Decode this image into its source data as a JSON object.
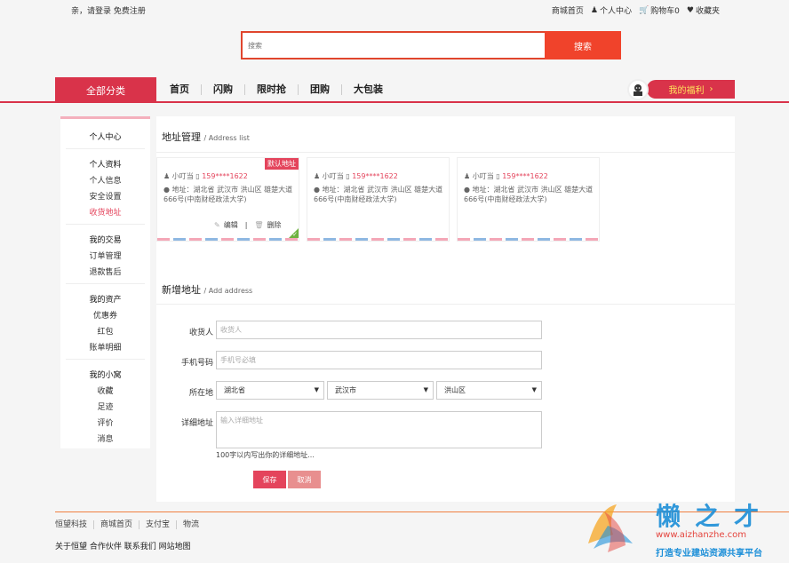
{
  "topbar": {
    "greeting": "亲，请登录 免费注册",
    "links": [
      "商城首页",
      "个人中心",
      "购物车0",
      "收藏夹"
    ]
  },
  "search": {
    "placeholder": "搜索",
    "button": "搜索"
  },
  "nav": {
    "all_categories": "全部分类",
    "links": [
      "首页",
      "闪购",
      "限时抢",
      "团购",
      "大包装"
    ],
    "welfare": "我的福利",
    "welfare_arrow": "›"
  },
  "sidebar": {
    "top": "个人中心",
    "groups": [
      {
        "head": "个人资料",
        "items": [
          "个人信息",
          "安全设置",
          "收货地址"
        ]
      },
      {
        "head": "我的交易",
        "items": [
          "订单管理",
          "退款售后"
        ]
      },
      {
        "head": "我的资产",
        "items": [
          "优惠券",
          "红包",
          "账单明细"
        ]
      },
      {
        "head": "我的小窝",
        "items": [
          "收藏",
          "足迹",
          "评价",
          "消息"
        ]
      }
    ],
    "active": "收货地址"
  },
  "address_section": {
    "title": "地址管理",
    "subtitle": "/ Address list"
  },
  "addresses": [
    {
      "name": "小叮当",
      "phone": "159****1622",
      "label": "地址：",
      "address": "湖北省 武汉市 洪山区 雄楚大道666号(中南财经政法大学)",
      "default_tag": "默认地址",
      "edit": "编辑",
      "sep": "|",
      "delete": "删除"
    },
    {
      "name": "小叮当",
      "phone": "159****1622",
      "label": "地址：",
      "address": "湖北省 武汉市 洪山区 雄楚大道666号(中南财经政法大学)"
    },
    {
      "name": "小叮当",
      "phone": "159****1622",
      "label": "地址：",
      "address": "湖北省 武汉市 洪山区 雄楚大道666号(中南财经政法大学)"
    }
  ],
  "new_section": {
    "title": "新增地址",
    "subtitle": "/ Add address"
  },
  "form": {
    "receiver_label": "收货人",
    "receiver_placeholder": "收货人",
    "phone_label": "手机号码",
    "phone_placeholder": "手机号必填",
    "region_label": "所在地",
    "province": "湖北省",
    "city": "武汉市",
    "district": "洪山区",
    "detail_label": "详细地址",
    "detail_placeholder": "输入详细地址",
    "hint": "100字以内写出你的详细地址...",
    "save": "保存",
    "cancel": "取消"
  },
  "footer": {
    "links": [
      "恒望科技",
      "商城首页",
      "支付宝",
      "物流"
    ],
    "bottom": "关于恒望 合作伙伴 联系我们 网站地图"
  },
  "watermark": {
    "brand": "懒之才",
    "url": "www.aizhanzhe.com",
    "tagline": "打造专业建站资源共享平台"
  },
  "colors": {
    "accent": "#d9334a",
    "search": "#f0432b",
    "default_tag": "#e4445c"
  }
}
